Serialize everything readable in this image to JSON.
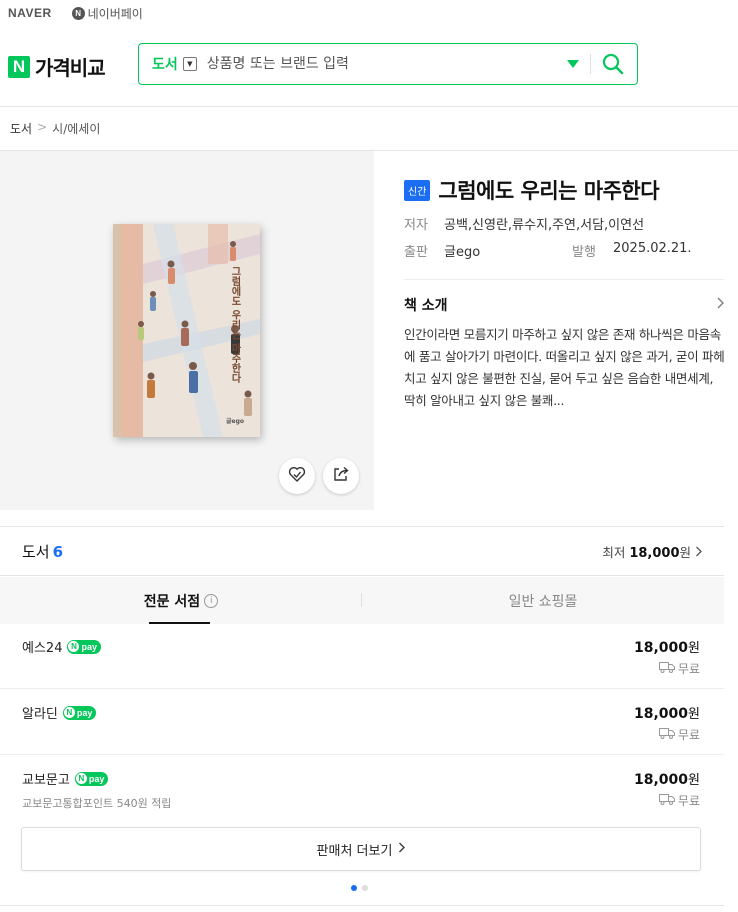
{
  "topbar": {
    "naver": "NAVER",
    "npay": "네이버페이",
    "npay_letter": "N"
  },
  "header": {
    "logo_letter": "N",
    "logo_text": "가격비교"
  },
  "search": {
    "category": "도서",
    "placeholder": "상품명 또는 브랜드 입력"
  },
  "breadcrumb": {
    "root": "도서",
    "sep": ">",
    "current": "시/에세이"
  },
  "cover": {
    "title_vertical": "그럼에도 우리는 마주한다",
    "publisher_mark": "글ego"
  },
  "book": {
    "badge": "신간",
    "title": "그럼에도 우리는 마주한다",
    "author_label": "저자",
    "authors": "공백,신영란,류수지,주연,서담,이연선",
    "publisher_label": "출판",
    "publisher": "글ego",
    "date_label": "발행",
    "date": "2025.02.21.",
    "intro_heading": "책 소개",
    "intro_text": "인간이라면 모름지기 마주하고 싶지 않은 존재 하나씩은 마음속에 품고 살아가기 마련이다. 떠올리고 싶지 않은 과거, 굳이 파헤치고 싶지 않은 불편한 진실, 묻어 두고 싶은 음습한 내면세계, 딱히 알아내고 싶지 않은 불쾌..."
  },
  "section": {
    "label": "도서",
    "count": "6",
    "lowest_label": "최저",
    "lowest_price": "18,000",
    "won": "원"
  },
  "tabs": [
    {
      "label": "전문 서점",
      "info": "i"
    },
    {
      "label": "일반 쇼핑몰"
    }
  ],
  "npay_label": "pay",
  "sellers": [
    {
      "name": "예스24",
      "price": "18,000",
      "won": "원",
      "shipping": "무료",
      "points": ""
    },
    {
      "name": "알라딘",
      "price": "18,000",
      "won": "원",
      "shipping": "무료",
      "points": ""
    },
    {
      "name": "교보문고",
      "price": "18,000",
      "won": "원",
      "shipping": "무료",
      "points": "교보문고통합포인트 540원 적립"
    }
  ],
  "more_button": "판매처 더보기",
  "colors": {
    "accent": "#03c75a",
    "blue": "#1b6ef3"
  }
}
